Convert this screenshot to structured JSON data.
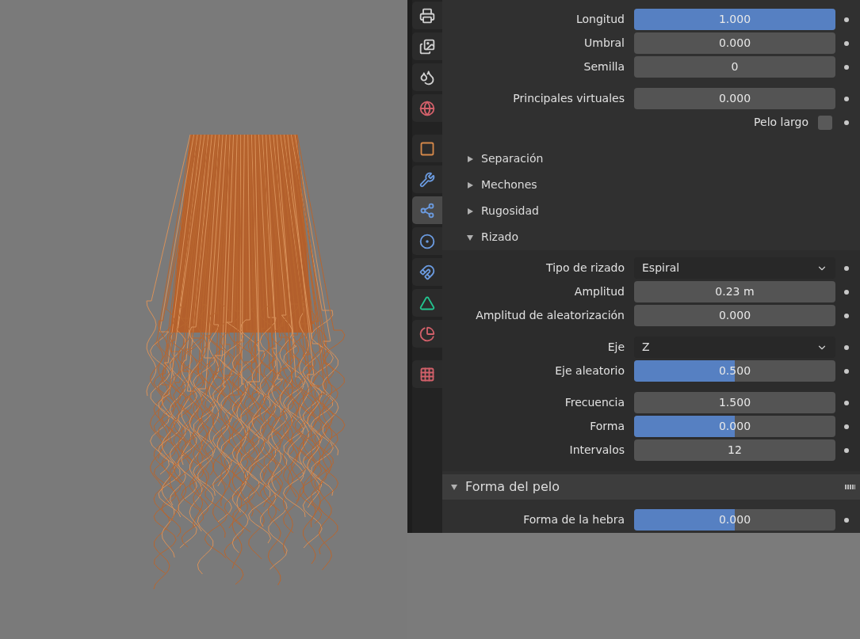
{
  "tab_groups": [
    [
      {
        "selected": false
      },
      {
        "selected": false
      },
      {
        "selected": false
      },
      {
        "selected": false
      }
    ],
    [
      {
        "selected": false
      },
      {
        "selected": false
      },
      {
        "selected": true
      },
      {
        "selected": false
      },
      {
        "selected": false
      },
      {
        "selected": false
      },
      {
        "selected": false
      }
    ],
    [
      {
        "selected": false
      }
    ]
  ],
  "top_groups": [
    [
      {
        "kind": "slider",
        "label": "Longitud",
        "value": "1.000",
        "level": 1
      },
      {
        "kind": "number",
        "label": "Umbral",
        "value": "0.000"
      },
      {
        "kind": "number",
        "label": "Semilla",
        "value": "0"
      }
    ],
    [
      {
        "kind": "number",
        "label": "Principales virtuales",
        "value": "0.000"
      },
      {
        "kind": "checkbox",
        "label": "Pelo largo",
        "checked": false
      }
    ]
  ],
  "subpanels": [
    {
      "label": "Separación",
      "expanded": false
    },
    {
      "label": "Mechones",
      "expanded": false
    },
    {
      "label": "Rugosidad",
      "expanded": false
    },
    {
      "label": "Rizado",
      "expanded": true,
      "groups": [
        [
          {
            "kind": "dropdown",
            "label": "Tipo de rizado",
            "value": "Espiral"
          },
          {
            "kind": "number",
            "label": "Amplitud",
            "value": "0.23 m"
          },
          {
            "kind": "number",
            "label": "Amplitud de aleatorización",
            "value": "0.000"
          }
        ],
        [
          {
            "kind": "dropdown",
            "label": "Eje",
            "value": "Z"
          },
          {
            "kind": "slider",
            "label": "Eje aleatorio",
            "value": "0.500",
            "level": 0.5
          }
        ],
        [
          {
            "kind": "number",
            "label": "Frecuencia",
            "value": "1.500"
          },
          {
            "kind": "slider",
            "label": "Forma",
            "value": "0.000",
            "level": 0.5
          },
          {
            "kind": "number",
            "label": "Intervalos",
            "value": "12"
          }
        ]
      ]
    }
  ],
  "panel": {
    "title": "Forma del pelo",
    "expanded": true,
    "groups": [
      [
        {
          "kind": "slider",
          "label": "Forma de la hebra",
          "value": "0.000",
          "level": 0.5
        }
      ]
    ]
  }
}
